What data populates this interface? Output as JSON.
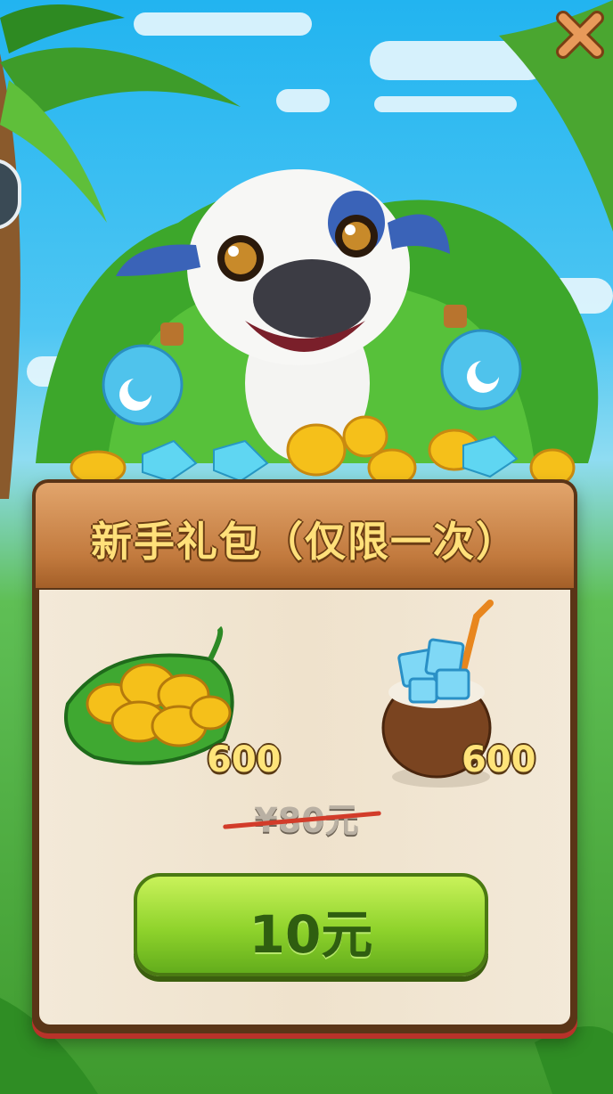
{
  "offer": {
    "title": "新手礼包（仅限一次）",
    "items": [
      {
        "icon": "gold-coins-on-leaf",
        "count": "600"
      },
      {
        "icon": "coconut-with-diamonds",
        "count": "600"
      }
    ],
    "original_price": "¥80元",
    "price_button_label": "10元"
  },
  "colors": {
    "title_text": "#ffe07a",
    "buy_button": "#8fd32c",
    "strike_line": "#d23c2a",
    "close_icon": "#e89a5a"
  }
}
